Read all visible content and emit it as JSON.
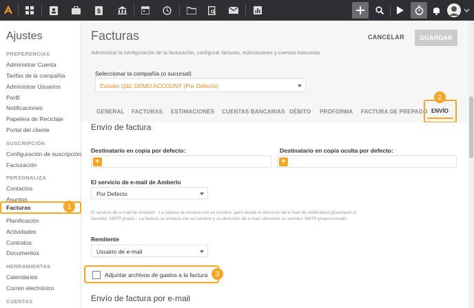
{
  "topbar": {
    "icons": [
      "logo-icon",
      "dashboard-icon",
      "contacts-icon",
      "briefcase-icon",
      "invoice-icon",
      "bank-icon",
      "calendar-icon",
      "history-icon",
      "folder-icon",
      "document-search-icon",
      "mail-icon",
      "reports-icon",
      "add-icon",
      "search-icon",
      "play-icon",
      "timer-icon",
      "bell-icon",
      "avatar"
    ]
  },
  "sidebar": {
    "title": "Ajustes",
    "sections": [
      {
        "label": "PREFERENCIAS",
        "items": [
          "Administrar Cuenta",
          "Tarifas de la compañía",
          "Administrar Usuarios",
          "Perfil",
          "Notificaciones",
          "Papelera de Reciclaje",
          "Portal del cliente"
        ]
      },
      {
        "label": "SUSCRIPCIÓN",
        "items": [
          "Configuración de suscripción",
          "Facturación"
        ]
      },
      {
        "label": "PERSONALIZA",
        "items": [
          "Contactos",
          "Asuntos",
          "Facturas",
          "Planificación",
          "Actividades",
          "Contratos",
          "Documentos"
        ]
      },
      {
        "label": "HERRAMIENTAS",
        "items": [
          "Calendarios",
          "Correo electrónico"
        ]
      },
      {
        "label": "CUENTAS",
        "items": []
      }
    ],
    "active": "Facturas"
  },
  "header": {
    "title": "Facturas",
    "description": "Administrar la configuración de la facturación, configurar facturas, estimaciones y cuentas bancarias",
    "cancel": "CANCELAR",
    "save": "GUARDAR"
  },
  "company": {
    "label": "Seleccionar la compañía (o sucursal)",
    "value": "Estudio Q&L DEMO ACCOUNT (Por Defecto)"
  },
  "tabs": [
    "GENERAL",
    "FACTURAS",
    "ESTIMACIONES",
    "CUENTAS BANCARIAS",
    "DÉBITO",
    "PROFORMA",
    "FACTURA DE PREPAGO",
    "ENVÍO"
  ],
  "active_tab": "ENVÍO",
  "form": {
    "section1": "Envío de factura",
    "cc_label": "Destinatario en copia por defecto:",
    "bcc_label": "Destinatario en copia oculta por defecto:",
    "email_service_label": "El servicio de e-mail de Amberlo",
    "email_service_value": "Por Defecto",
    "help1": "El servicio de e-mail de Amberlo - La factura se enviará con su nombre, pero desde la dirección de e-mail de notifications@amberlo.io",
    "help2": "Servidor SMTP propio - La factura se enviará con su nombre y su dirección de e-mail utilizando su servidor SMTP proporcionado.",
    "sender_label": "Remitente",
    "sender_value": "Usuario de e-mail",
    "attach_label": "Adjuntar archivos de gastos a la factura",
    "attach_checked": false,
    "section2": "Envío de factura por e-mail"
  },
  "badges": [
    "1",
    "2",
    "3"
  ],
  "colors": {
    "accent": "#f5a623",
    "topbar": "#2e2e33",
    "company_text": "#e8891a"
  }
}
